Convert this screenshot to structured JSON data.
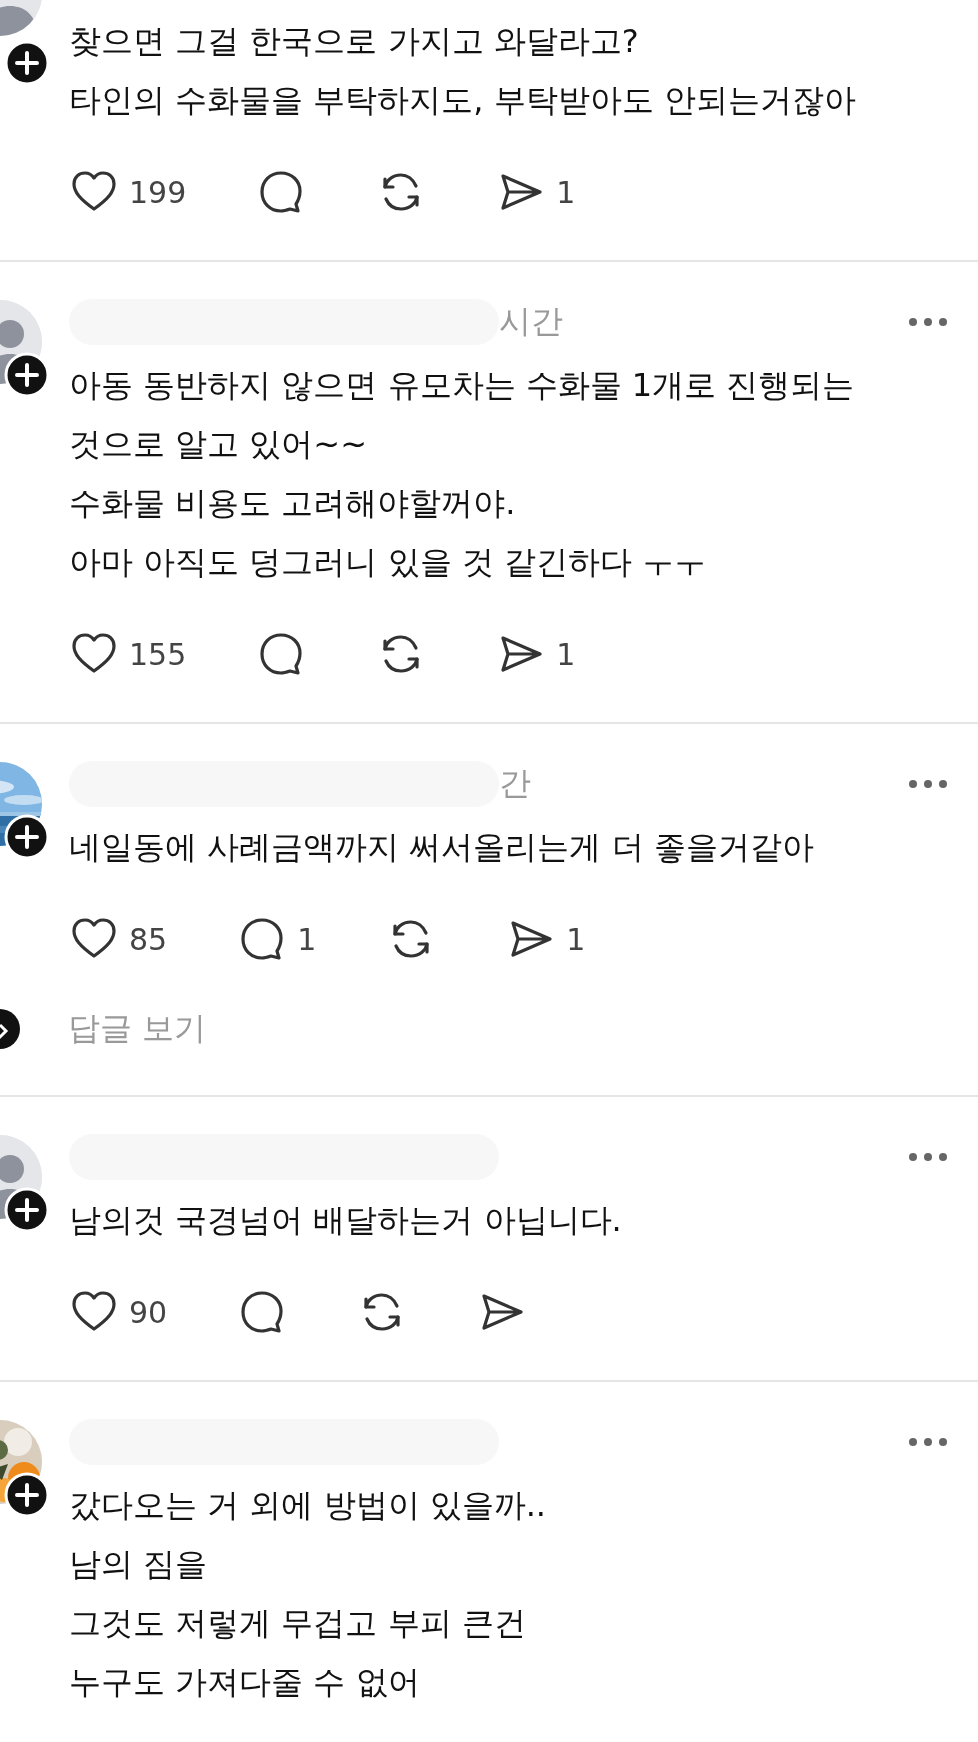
{
  "posts": [
    {
      "avatar": {
        "kind": "default"
      },
      "name_redacted": false,
      "more_menu": false,
      "lines": [
        "찾으면 그걸 한국으로 가지고 와달라고?",
        "타인의 수화물을 부탁하지도, 부탁받아도 안되는거잖아"
      ],
      "likes": "199",
      "shares": "1"
    },
    {
      "avatar": {
        "kind": "default"
      },
      "name_redacted": true,
      "time": "시간",
      "more_menu": true,
      "lines": [
        "아동 동반하지 않으면 유모차는 수화물 1개로 진행되는",
        "것으로 알고 있어~~",
        "수화물 비용도 고려해야할꺼야.",
        "아마 아직도 덩그러니 있을 것 같긴하다 ㅜㅜ"
      ],
      "likes": "155",
      "shares": "1"
    },
    {
      "avatar": {
        "kind": "picture"
      },
      "name_redacted": true,
      "time": "간",
      "more_menu": true,
      "lines": [
        "네일동에 사례금액까지 써서올리는게 더 좋을거같아"
      ],
      "likes": "85",
      "replies": "1",
      "shares": "1",
      "view_replies": "답글 보기"
    },
    {
      "avatar": {
        "kind": "default"
      },
      "name_redacted": true,
      "more_menu": true,
      "lines": [
        "남의것 국경넘어 배달하는거 아닙니다."
      ],
      "likes": "90"
    },
    {
      "avatar": {
        "kind": "picture"
      },
      "name_redacted": true,
      "more_menu": true,
      "lines": [
        "갔다오는 거 외에 방법이 있을까..",
        "남의 짐을",
        "그것도 저렇게 무겁고 부피 큰건",
        "누구도 가져다줄 수 없어"
      ]
    }
  ]
}
